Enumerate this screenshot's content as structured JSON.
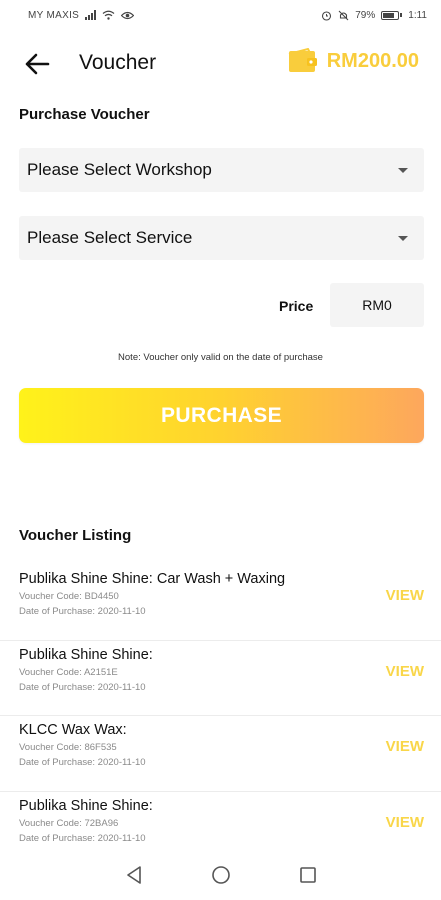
{
  "status_bar": {
    "carrier": "MY MAXIS",
    "battery": "79%",
    "time": "1:11"
  },
  "header": {
    "title": "Voucher",
    "wallet_balance": "RM200.00",
    "wallet_color": "#f9cd3c"
  },
  "purchase_section": {
    "title": "Purchase Voucher",
    "workshop_select": {
      "value": "Please Select Workshop"
    },
    "service_select": {
      "value": "Please Select Service"
    },
    "price_label": "Price",
    "price_value": "RM0",
    "note": "Note: Voucher only valid on the date of purchase",
    "purchase_label": "PURCHASE"
  },
  "listing": {
    "title": "Voucher Listing",
    "view_label": "VIEW",
    "items": [
      {
        "name": "Publika Shine Shine: Car Wash + Waxing",
        "code": "Voucher Code: BD4450",
        "date": "Date of Purchase: 2020-11-10"
      },
      {
        "name": "Publika Shine Shine:",
        "code": "Voucher Code: A2151E",
        "date": "Date of Purchase: 2020-11-10"
      },
      {
        "name": "KLCC Wax Wax:",
        "code": "Voucher Code: 86F535",
        "date": "Date of Purchase: 2020-11-10"
      },
      {
        "name": "Publika Shine Shine:",
        "code": "Voucher Code: 72BA96",
        "date": "Date of Purchase: 2020-11-10"
      }
    ]
  },
  "icons": {
    "back": "arrow-left-icon",
    "wallet": "wallet-icon",
    "nav_back": "triangle-back-icon",
    "nav_home": "circle-home-icon",
    "nav_recents": "square-recents-icon"
  },
  "colors": {
    "accent_yellow": "#f9d649",
    "gradient_start": "#fff21a",
    "gradient_end": "#fda75d"
  }
}
